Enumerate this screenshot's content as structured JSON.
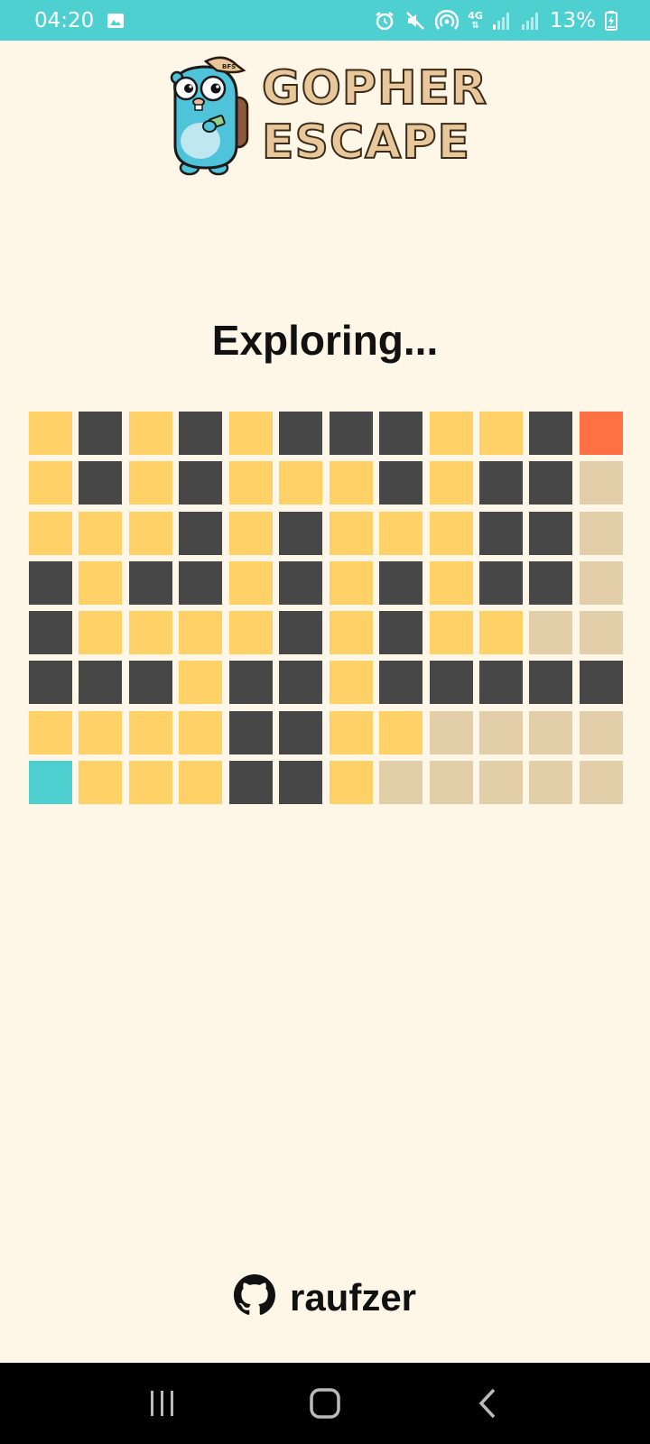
{
  "status_bar": {
    "time": "04:20",
    "battery": "13%",
    "network": "4G",
    "background": "#4DD0CF"
  },
  "logo": {
    "title_line1": "GOPHER",
    "title_line2": "ESCAPE",
    "hat_text": "BFS"
  },
  "heading": "Exploring...",
  "maze": {
    "rows": 8,
    "cols": 12,
    "legend": {
      "W": "#474747",
      "V": "#FFD166",
      "U": "#E2CEA8",
      "S": "#4DD0CF",
      "G": "#FF7043"
    },
    "grid": [
      "VWVWVWWWVVWG",
      "VWVWVVVWVWWU",
      "VVVWVWVVVWWU",
      "WVWWVWVWVWWU",
      "WVVVVWVWVVUU",
      "WWWVWWVWWWWW",
      "VVVVWWVVUUUU",
      "SVVVWWVUUUUU"
    ]
  },
  "footer": {
    "username": "raufzer",
    "icon": "github-icon"
  },
  "nav": {
    "recents_icon": "recents-icon",
    "home_icon": "home-icon",
    "back_icon": "back-icon"
  }
}
